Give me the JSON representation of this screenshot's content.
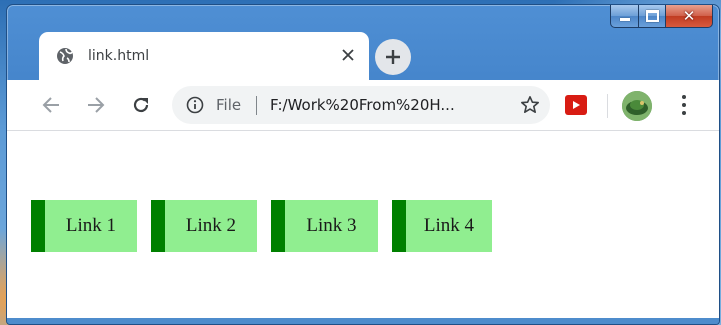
{
  "window": {
    "caption_buttons": [
      "minimize-icon",
      "maximize-icon",
      "close-icon"
    ]
  },
  "tab": {
    "title": "link.html",
    "favicon": "globe-icon",
    "close_icon": "close-icon",
    "new_tab_icon": "plus-icon"
  },
  "toolbar": {
    "back_icon": "arrow-left-icon",
    "forward_icon": "arrow-right-icon",
    "reload_icon": "reload-icon",
    "omnibox": {
      "info_icon": "info-icon",
      "scheme_label": "File",
      "url": "F:/Work%20From%20H...",
      "star_icon": "star-icon"
    },
    "extension_icon": "youtube-icon",
    "menu_icon": "more-vert-icon"
  },
  "page": {
    "links": [
      "Link 1",
      "Link 2",
      "Link 3",
      "Link 4"
    ],
    "link_background": "#90ee90",
    "link_accent": "#008000"
  }
}
